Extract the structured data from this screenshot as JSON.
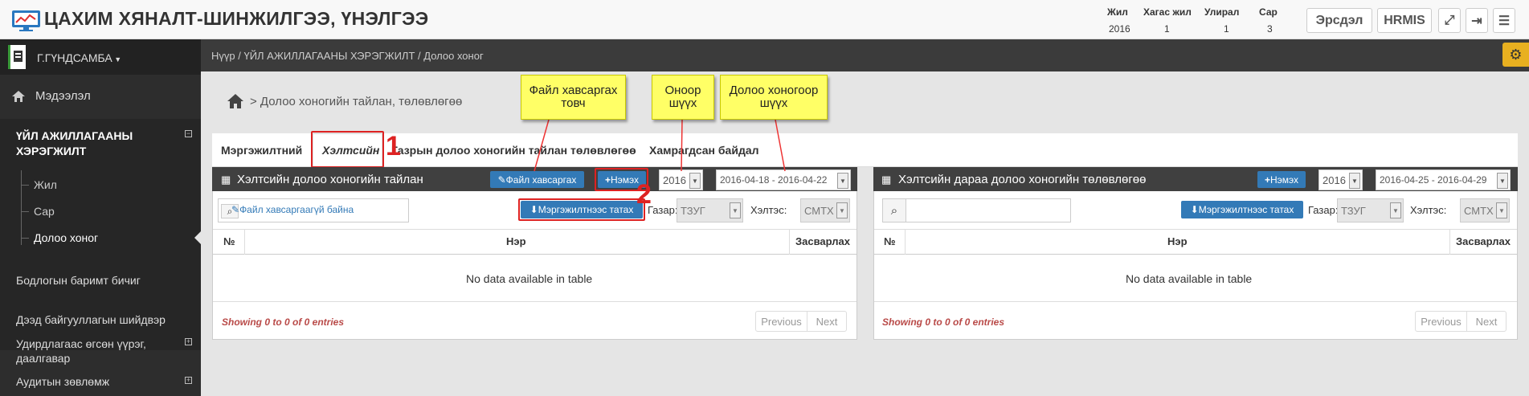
{
  "app": {
    "title": "ЦАХИМ ХЯНАЛТ-ШИНЖИЛГЭЭ, ҮНЭЛГЭЭ"
  },
  "period": {
    "headers": [
      "Жил",
      "Хагас жил",
      "Улирал",
      "Сар"
    ],
    "values": [
      "2016",
      "1",
      "1",
      "3"
    ]
  },
  "topbar": {
    "btn_ersdel": "Эрсдэл",
    "btn_hrmis": "HRMIS"
  },
  "user": {
    "name": "Г.ГҮНДСАМБА"
  },
  "sidebar": {
    "info": "Мэдээлэл",
    "activity": "ҮЙЛ АЖИЛЛАГААНЫ ХЭРЭГЖИЛТ",
    "sub": [
      "Жил",
      "Сар",
      "Долоо хоног"
    ],
    "items": [
      "Бодлогын баримт бичиг",
      "Дээд байгууллагын шийдвэр",
      "Удирдлагаас өгсөн үүрэг, даалгавар",
      "Аудитын зөвлөмж"
    ]
  },
  "breadcrumb": {
    "home": "Нүүр",
    "section": "ҮЙЛ АЖИЛЛАГААНЫ ХЭРЭГЖИЛТ",
    "current": "Долоо хоног"
  },
  "page": {
    "heading": "> Долоо хоногийн тайлан, төлөвлөгөө"
  },
  "tabs": [
    "Мэргэжилтний",
    "Хэлтсийн",
    "Газрын долоо хоногийн тайлан төлөвлөгөө",
    "Хамрагдсан байдал"
  ],
  "left": {
    "title": "Хэлтсийн долоо хоногийн тайлан",
    "attach_btn": "Файл хавсаргах",
    "add_btn": "Нэмэх",
    "year": "2016",
    "week": "2016-04-18 - 2016-04-22",
    "file_text": "Файл хавсаргаагүй байна",
    "pull_btn": "Мэргэжилтнээс татах",
    "gazar_label": "Газар:",
    "gazar_val": "ТЗУГ",
    "helts_label": "Хэлтэс:",
    "helts_val": "СМТХ",
    "cols": [
      "№",
      "Нэр",
      "Засварлах"
    ],
    "empty": "No data available in table",
    "info": "Showing 0 to 0 of 0 entries",
    "prev": "Previous",
    "next": "Next"
  },
  "right": {
    "title": "Хэлтсийн дараа долоо хоногийн төлөвлөгөө",
    "add_btn": "Нэмэх",
    "year": "2016",
    "week": "2016-04-25 - 2016-04-29",
    "pull_btn": "Мэргэжилтнээс татах",
    "gazar_label": "Газар:",
    "gazar_val": "ТЗУГ",
    "helts_label": "Хэлтэс:",
    "helts_val": "СМТХ",
    "cols": [
      "№",
      "Нэр",
      "Засварлах"
    ],
    "empty": "No data available in table",
    "info": "Showing 0 to 0 of 0 entries",
    "prev": "Previous",
    "next": "Next"
  },
  "callouts": {
    "attach": "Файл хавсаргах товч",
    "year": "Оноор шүүх",
    "week": "Долоо хоногоор шүүх"
  },
  "markers": [
    "1",
    "2"
  ],
  "colors": {
    "accent": "#337ab7",
    "callout": "#ffff66",
    "marker": "#dd2222",
    "sidebar": "#2d2d2d"
  }
}
